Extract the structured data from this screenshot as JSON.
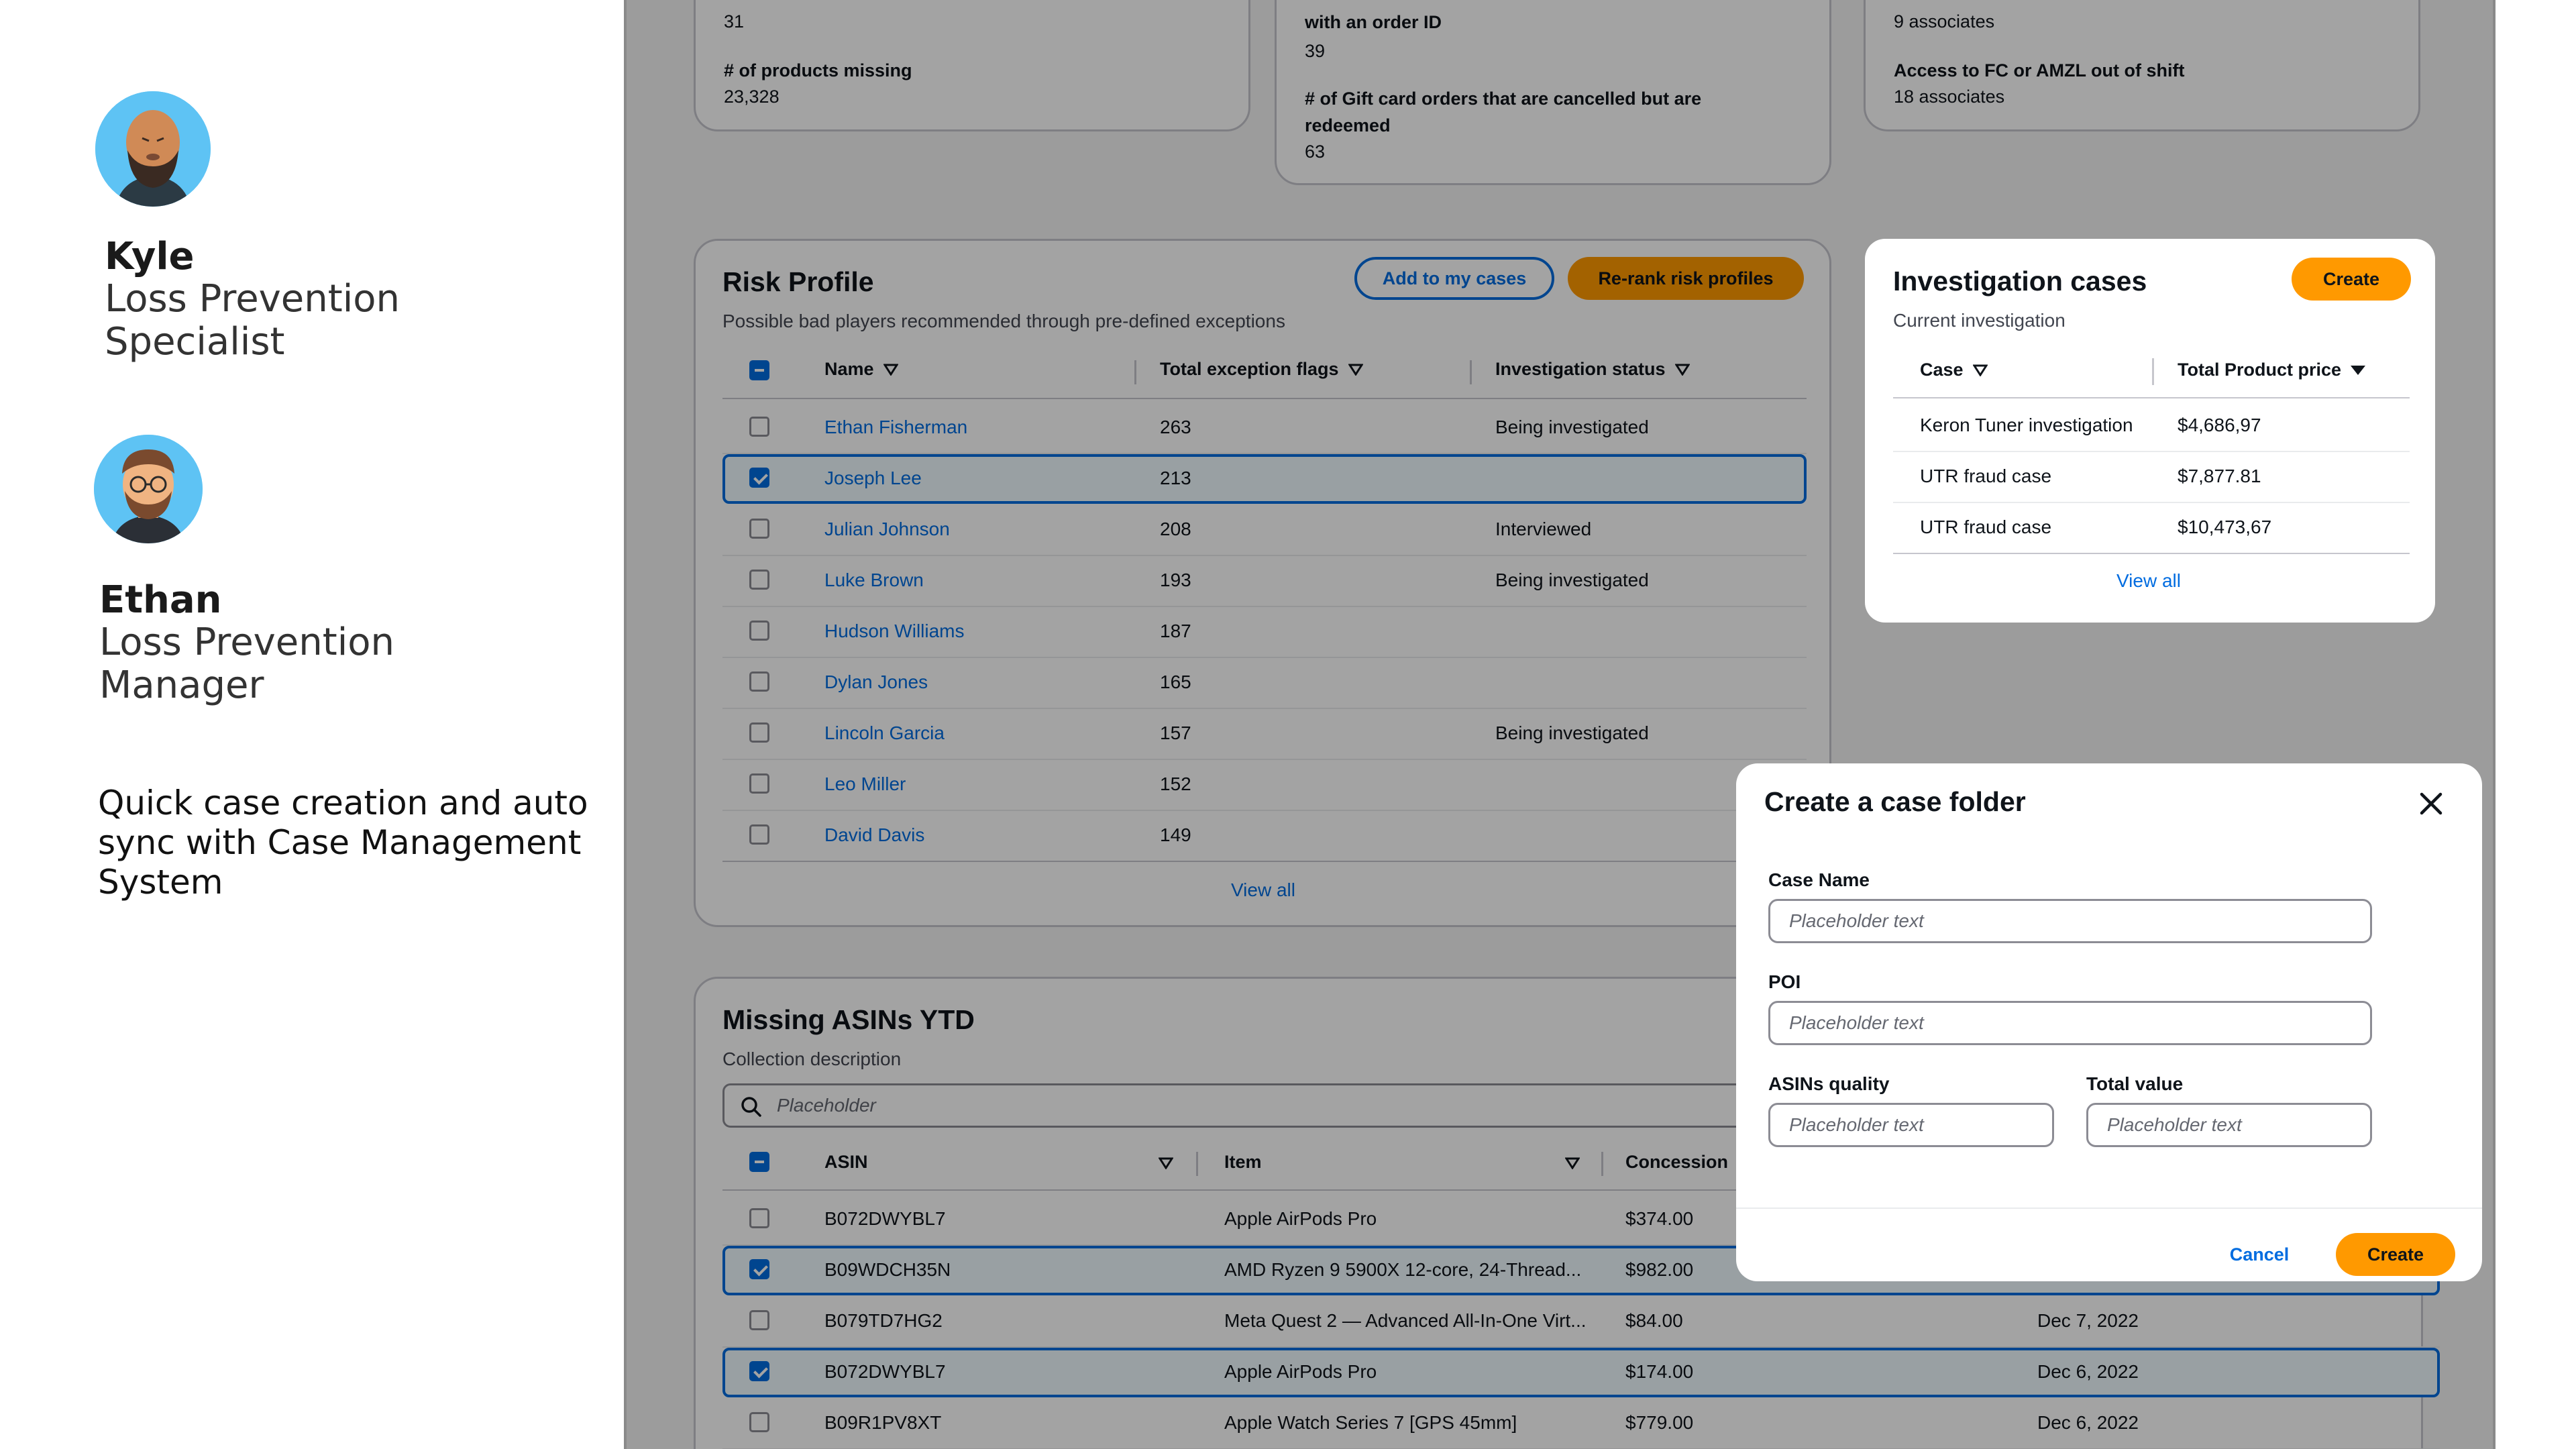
{
  "personas": [
    {
      "name": "Kyle",
      "role": "Loss Prevention Specialist"
    },
    {
      "name": "Ethan",
      "role": "Loss Prevention Manager"
    }
  ],
  "note": "Quick case creation and auto sync with Case Management System",
  "metrics": {
    "card1": {
      "top_value": "31",
      "label2": "# of products missing",
      "value2": "23,328"
    },
    "card2": {
      "label1_cont": "with an order ID",
      "value1": "39",
      "label2_line1": "# of Gift card orders that are cancelled  but are",
      "label2_line2": "redeemed",
      "value2": "63"
    },
    "card3": {
      "value1": "9 associates",
      "label2": "Access to FC or AMZL out of shift",
      "value2": "18 associates"
    }
  },
  "risk_profile": {
    "title": "Risk Profile",
    "description": "Possible bad players recommended through pre-defined exceptions",
    "add_button": "Add to my cases",
    "rerank_button": "Re-rank risk profiles",
    "columns": [
      "Name",
      "Total exception flags",
      "Investigation status"
    ],
    "rows": [
      {
        "name": "Ethan Fisherman",
        "flags": "263",
        "status": "Being investigated",
        "checked": false
      },
      {
        "name": "Joseph Lee",
        "flags": "213",
        "status": "",
        "checked": true
      },
      {
        "name": "Julian Johnson",
        "flags": "208",
        "status": "Interviewed",
        "checked": false
      },
      {
        "name": "Luke Brown",
        "flags": "193",
        "status": "Being investigated",
        "checked": false
      },
      {
        "name": "Hudson Williams",
        "flags": "187",
        "status": "",
        "checked": false
      },
      {
        "name": "Dylan Jones",
        "flags": "165",
        "status": "",
        "checked": false
      },
      {
        "name": "Lincoln Garcia",
        "flags": "157",
        "status": "Being investigated",
        "checked": false
      },
      {
        "name": "Leo Miller",
        "flags": "152",
        "status": "",
        "checked": false
      },
      {
        "name": "David Davis",
        "flags": "149",
        "status": "",
        "checked": false
      }
    ],
    "view_all": "View all"
  },
  "missing_asins": {
    "title": "Missing ASINs YTD",
    "description": "Collection description",
    "search_placeholder": "Placeholder",
    "columns": [
      "ASIN",
      "Item",
      "Concession"
    ],
    "rows": [
      {
        "asin": "B072DWYBL7",
        "item": "Apple AirPods Pro",
        "concession": "$374.00",
        "date": "",
        "checked": false
      },
      {
        "asin": "B09WDCH35N",
        "item": "AMD Ryzen 9 5900X 12-core, 24-Thread...",
        "concession": "$982.00",
        "date": "",
        "checked": true
      },
      {
        "asin": "B079TD7HG2",
        "item": "Meta Quest 2 — Advanced All-In-One Virt...",
        "concession": "$84.00",
        "date": "Dec 7, 2022",
        "checked": false
      },
      {
        "asin": "B072DWYBL7",
        "item": "Apple AirPods Pro",
        "concession": "$174.00",
        "date": "Dec 6, 2022",
        "checked": true
      },
      {
        "asin": "B09R1PV8XT",
        "item": "Apple Watch Series 7 [GPS 45mm]",
        "concession": "$779.00",
        "date": "Dec 6, 2022",
        "checked": false
      }
    ]
  },
  "investigation": {
    "title": "Investigation cases",
    "description": "Current investigation",
    "create_button": "Create",
    "columns": [
      "Case",
      "Total Product price"
    ],
    "rows": [
      {
        "case": "Keron Tuner investigation",
        "price": "$4,686,97"
      },
      {
        "case": "UTR fraud case",
        "price": "$7,877.81"
      },
      {
        "case": "UTR fraud case",
        "price": "$10,473,67"
      }
    ],
    "view_all": "View all"
  },
  "modal": {
    "title": "Create a case folder",
    "case_name_label": "Case Name",
    "case_name_placeholder": "Placeholder text",
    "poi_label": "POI",
    "poi_placeholder": "Placeholder text",
    "asins_label": "ASINs quality",
    "asins_placeholder": "Placeholder text",
    "total_label": "Total value",
    "total_placeholder": "Placeholder text",
    "cancel_button": "Cancel",
    "create_button": "Create"
  },
  "colors": {
    "accent": "#006ce0",
    "primary_button": "#ff9900",
    "avatar_bg": "#5ec3f4"
  }
}
